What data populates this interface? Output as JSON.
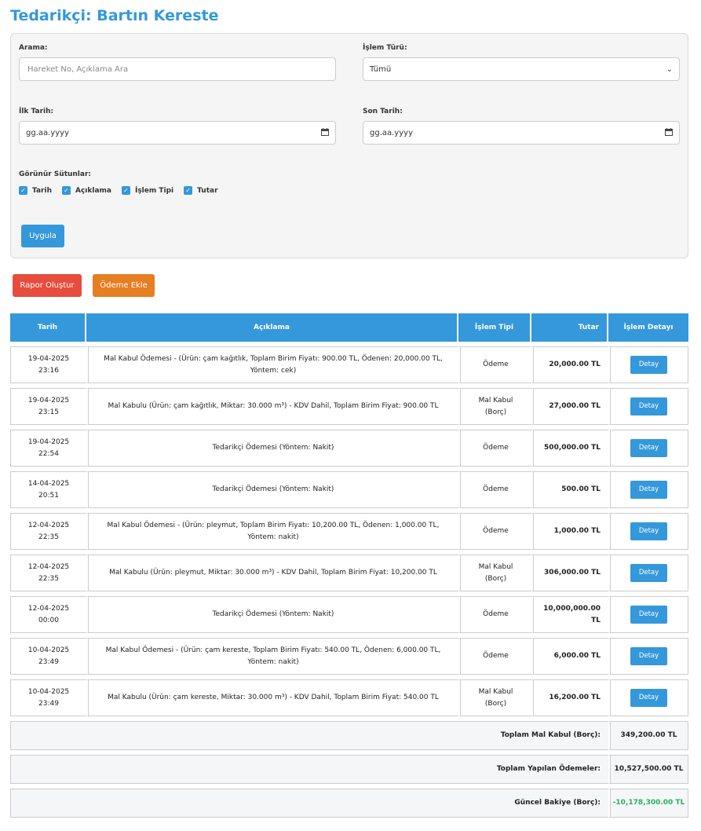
{
  "header": {
    "title": "Tedarikçi: Bartın Kereste"
  },
  "filters": {
    "search_label": "Arama:",
    "search_placeholder": "Hareket No, Açıklama Ara",
    "type_label": "İşlem Türü:",
    "type_value": "Tümü",
    "start_label": "İlk Tarih:",
    "start_value": "gg.aa.yyyy",
    "end_label": "Son Tarih:",
    "end_value": "gg.aa.yyyy",
    "columns_label": "Görünür Sütunlar:",
    "columns": [
      "Tarih",
      "Açıklama",
      "İşlem Tipi",
      "Tutar"
    ],
    "apply_label": "Uygula"
  },
  "actions": {
    "report_label": "Rapor Oluştur",
    "payment_label": "Ödeme Ekle"
  },
  "colors": {
    "accent": "#3498db",
    "danger": "#e74c3c",
    "warning": "#e67e22",
    "positive": "#27ae60"
  },
  "table": {
    "headers": [
      "Tarih",
      "Açıklama",
      "İşlem Tipi",
      "Tutar",
      "İşlem Detayı"
    ],
    "detail_label": "Detay",
    "rows": [
      {
        "date": "19-04-2025",
        "time": "23:16",
        "desc": "Mal Kabul Ödemesi - (Ürün: çam kağıtlık, Toplam Birim Fiyatı: 900.00 TL, Ödenen: 20,000.00 TL, Yöntem: cek)",
        "type1": "Ödeme",
        "type2": "",
        "amount": "20,000.00 TL"
      },
      {
        "date": "19-04-2025",
        "time": "23:15",
        "desc": "Mal Kabulu (Ürün: çam kağıtlık, Miktar: 30.000 m³) - KDV Dahil, Toplam Birim Fiyat: 900.00 TL",
        "type1": "Mal Kabul",
        "type2": "(Borç)",
        "amount": "27,000.00 TL"
      },
      {
        "date": "19-04-2025",
        "time": "22:54",
        "desc": "Tedarikçi Ödemesi (Yöntem: Nakit)",
        "type1": "Ödeme",
        "type2": "",
        "amount": "500,000.00 TL"
      },
      {
        "date": "14-04-2025",
        "time": "20:51",
        "desc": "Tedarikçi Ödemesi (Yöntem: Nakit)",
        "type1": "Ödeme",
        "type2": "",
        "amount": "500.00 TL"
      },
      {
        "date": "12-04-2025",
        "time": "22:35",
        "desc": "Mal Kabul Ödemesi - (Ürün: pleymut, Toplam Birim Fiyatı: 10,200.00 TL, Ödenen: 1,000.00 TL, Yöntem: nakit)",
        "type1": "Ödeme",
        "type2": "",
        "amount": "1,000.00 TL"
      },
      {
        "date": "12-04-2025",
        "time": "22:35",
        "desc": "Mal Kabulu (Ürün: pleymut, Miktar: 30.000 m³) - KDV Dahil, Toplam Birim Fiyat: 10,200.00 TL",
        "type1": "Mal Kabul",
        "type2": "(Borç)",
        "amount": "306,000.00 TL"
      },
      {
        "date": "12-04-2025",
        "time": "00:00",
        "desc": "Tedarikçi Ödemesi (Yöntem: Nakit)",
        "type1": "Ödeme",
        "type2": "",
        "amount": "10,000,000.00 TL"
      },
      {
        "date": "10-04-2025",
        "time": "23:49",
        "desc": "Mal Kabul Ödemesi - (Ürün: çam kereste, Toplam Birim Fiyatı: 540.00 TL, Ödenen: 6,000.00 TL, Yöntem: nakit)",
        "type1": "Ödeme",
        "type2": "",
        "amount": "6,000.00 TL"
      },
      {
        "date": "10-04-2025",
        "time": "23:49",
        "desc": "Mal Kabulu (Ürün: çam kereste, Miktar: 30.000 m³) - KDV Dahil, Toplam Birim Fiyat: 540.00 TL",
        "type1": "Mal Kabul",
        "type2": "(Borç)",
        "amount": "16,200.00 TL"
      }
    ]
  },
  "summary": {
    "total_receipt_label": "Toplam Mal Kabul (Borç):",
    "total_receipt_value": "349,200.00 TL",
    "total_paid_label": "Toplam Yapılan Ödemeler:",
    "total_paid_value": "10,527,500.00 TL",
    "balance_label": "Güncel Bakiye (Borç):",
    "balance_value": "-10,178,300.00 TL"
  }
}
